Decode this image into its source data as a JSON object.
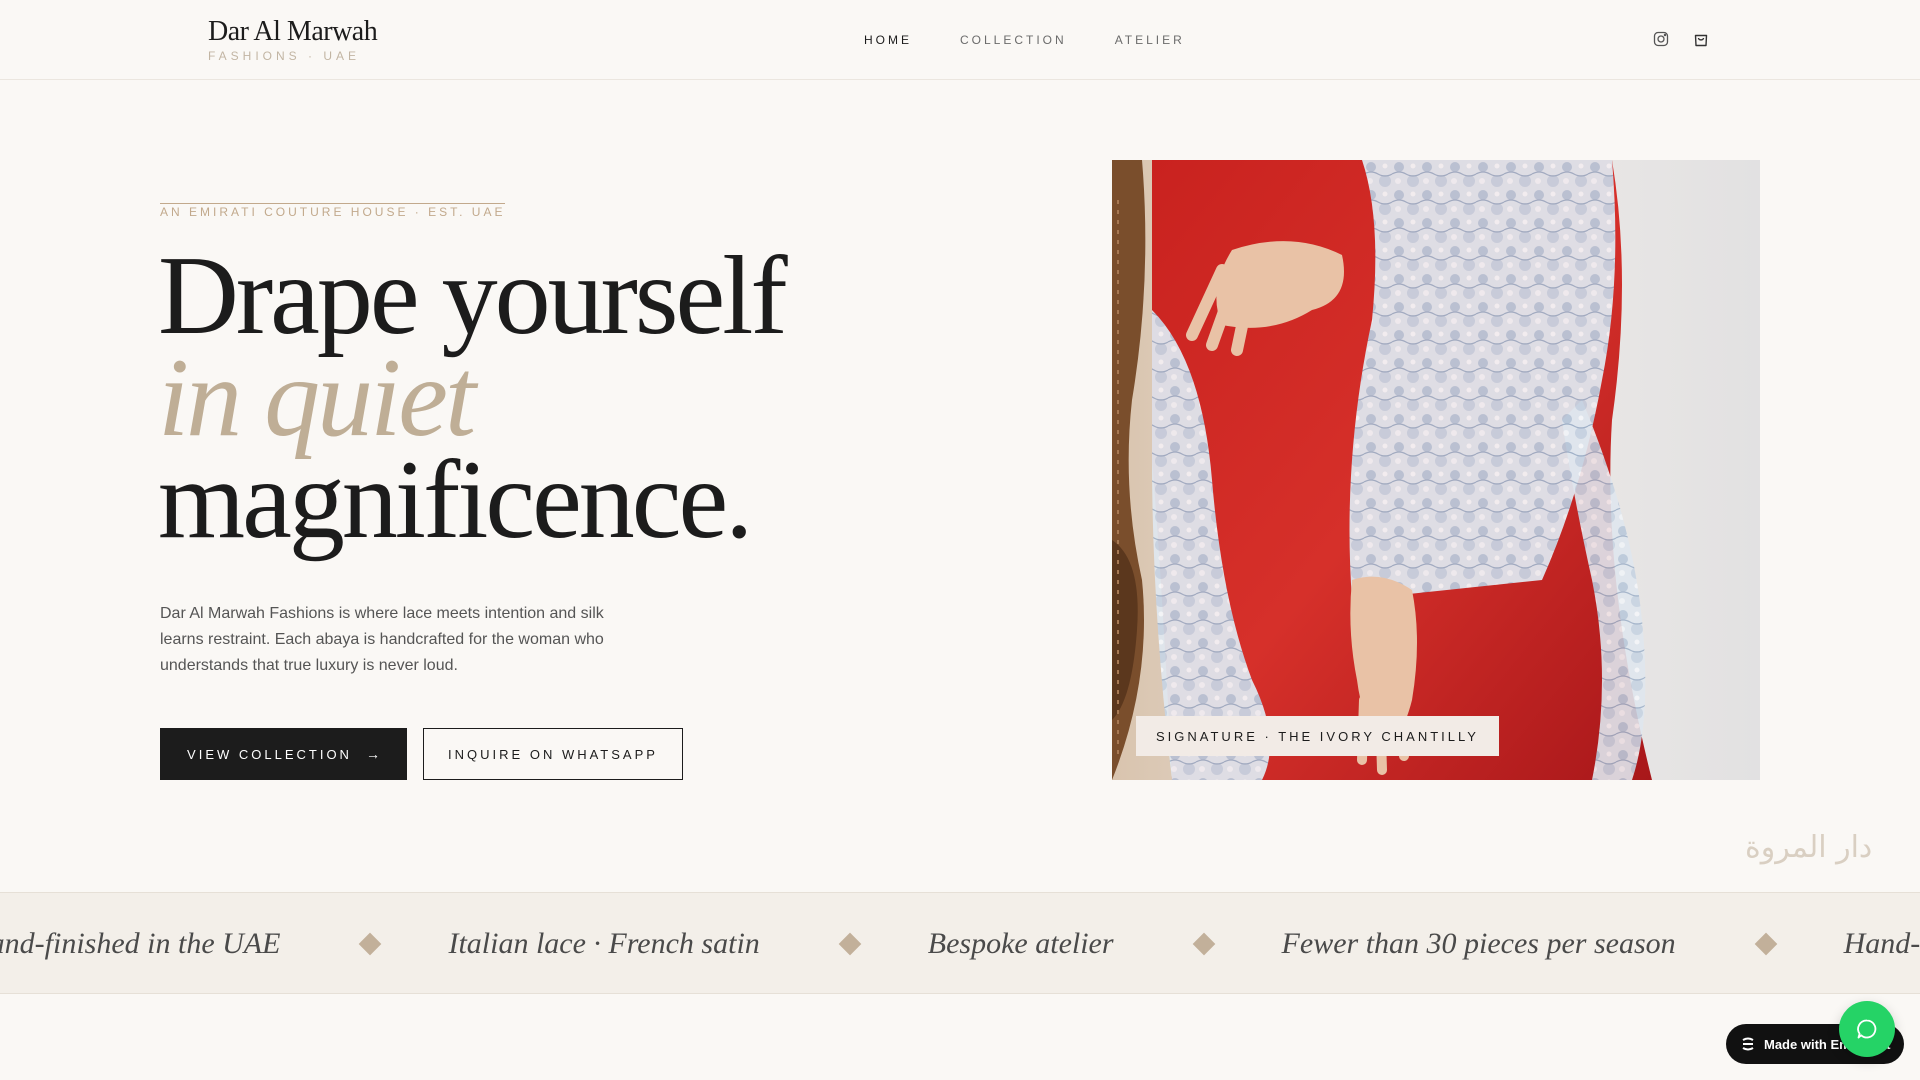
{
  "brand": {
    "name": "Dar Al Marwah",
    "subtitle": "FASHIONS · UAE"
  },
  "nav": {
    "items": [
      {
        "label": "HOME",
        "active": true
      },
      {
        "label": "COLLECTION",
        "active": false
      },
      {
        "label": "ATELIER",
        "active": false
      }
    ]
  },
  "header_icons": [
    "instagram-icon",
    "shopping-bag-icon"
  ],
  "hero": {
    "eyebrow": "AN EMIRATI COUTURE HOUSE · EST. UAE",
    "headline": {
      "line1": "Drape yourself",
      "line2": "in quiet",
      "line3": "magnificence."
    },
    "intro": "Dar Al Marwah Fashions is where lace meets intention and silk learns restraint. Each abaya is handcrafted for the woman who understands that true luxury is never loud.",
    "primary_button": {
      "label": "VIEW COLLECTION",
      "icon": "→"
    },
    "secondary_button": {
      "label": "INQUIRE ON WHATSAPP"
    },
    "image_caption": "SIGNATURE · THE IVORY CHANTILLY"
  },
  "arabic_mark": "دار المروة",
  "marquee": {
    "items": [
      "Hand-finished in the UAE",
      "Italian lace · French satin",
      "Bespoke atelier",
      "Fewer than 30 pieces per season",
      "Hand-finished in the UAE"
    ]
  },
  "badge": {
    "label": "Made with Emergent"
  },
  "colors": {
    "background": "#faf8f5",
    "text": "#1c1c1c",
    "accent": "#bfae96",
    "button_dark": "#1c1c1c",
    "whatsapp": "#25d366"
  }
}
